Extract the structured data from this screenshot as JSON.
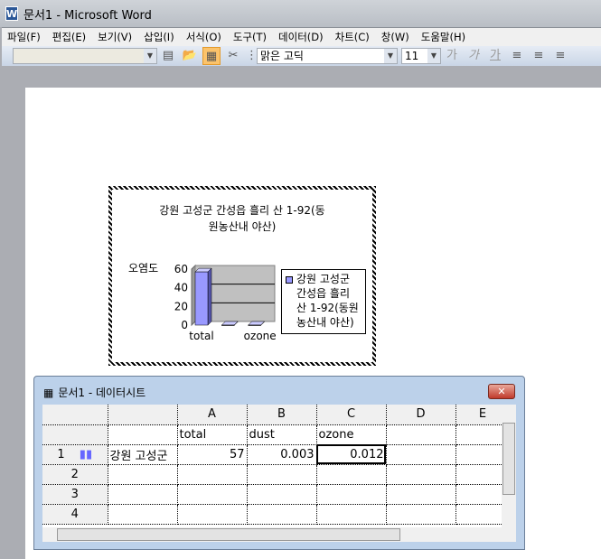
{
  "window": {
    "title": "문서1 - Microsoft Word",
    "app_icon": "W"
  },
  "menu": [
    "파일(F)",
    "편집(E)",
    "보기(V)",
    "삽입(I)",
    "서식(O)",
    "도구(T)",
    "데이터(D)",
    "차트(C)",
    "창(W)",
    "도움말(H)"
  ],
  "toolbar": {
    "chart_object_combo": "",
    "font": "맑은 고딕",
    "size": "11",
    "bold": "가",
    "italic": "가",
    "underline": "가"
  },
  "chart_data": {
    "type": "bar",
    "title": "강원 고성군 간성읍 흘리 산 1-92(동원농산내 야산)",
    "title_lines": [
      "강원 고성군 간성읍 흘리 산 1-92(동",
      "원농산내 야산)"
    ],
    "ylabel": "오염도",
    "categories": [
      "total",
      "dust",
      "ozone"
    ],
    "visible_x_ticks": [
      "total",
      "ozone"
    ],
    "ylim": [
      0,
      60
    ],
    "yticks": [
      "0",
      "20",
      "40",
      "60"
    ],
    "series": [
      {
        "name": "강원 고성군 간성읍 흘리 산 1-92(동원농산내 야산)",
        "values": [
          57,
          0.003,
          0.012
        ],
        "color": "#9999ff"
      }
    ],
    "legend_lines": [
      "강원 고성군",
      "간성읍 흘리",
      "산 1-92(동원",
      "농산내 야산)"
    ],
    "legend": "right"
  },
  "datasheet": {
    "title": "문서1 - 데이터시트",
    "columns": [
      "A",
      "B",
      "C",
      "D",
      "E"
    ],
    "header_row": [
      "total",
      "dust",
      "ozone",
      "",
      ""
    ],
    "rows": [
      {
        "n": "1",
        "label": "강원 고성군",
        "cells": [
          "57",
          "0.003",
          "0.012",
          "",
          ""
        ]
      },
      {
        "n": "2"
      },
      {
        "n": "3"
      },
      {
        "n": "4"
      }
    ]
  }
}
